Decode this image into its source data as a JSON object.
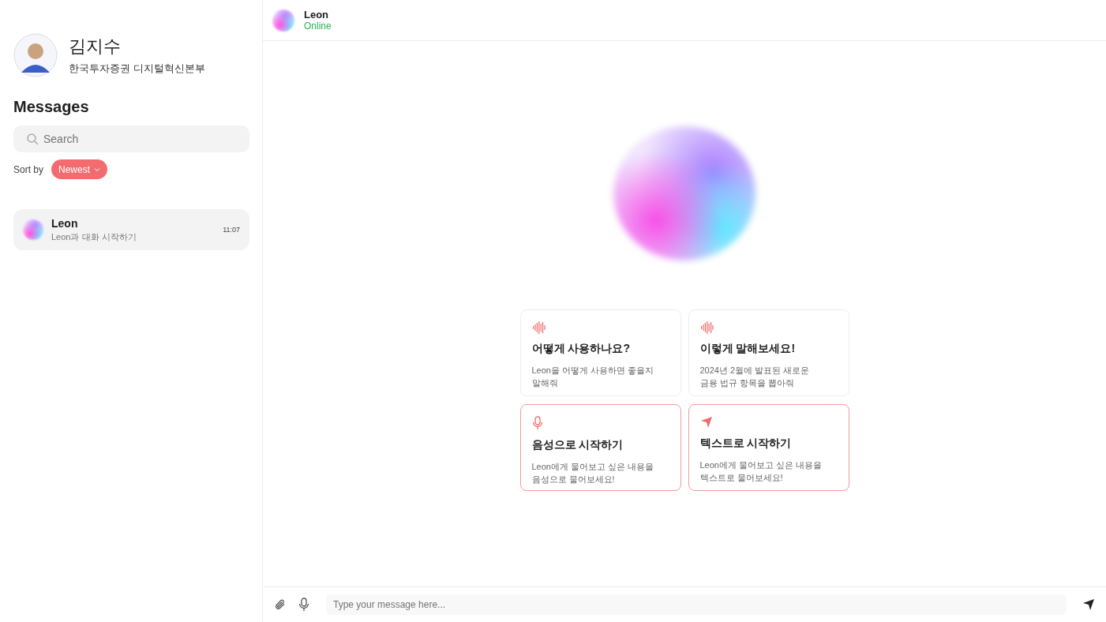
{
  "profile": {
    "name": "김지수",
    "department": "한국투자증권 디지털혁신본부"
  },
  "sidebar": {
    "title": "Messages",
    "search": {
      "placeholder": "Search"
    },
    "sort": {
      "label": "Sort by",
      "value": "Newest"
    },
    "conversations": [
      {
        "name": "Leon",
        "preview": "Leon과 대화 시작하기",
        "time": "11:07"
      }
    ]
  },
  "chat": {
    "name": "Leon",
    "status": "Online",
    "cards": [
      {
        "kind": "prompt",
        "title": "어떻게 사용하나요?",
        "lines": [
          "Leon을 어떻게 사용하면 좋을지",
          "말해줘"
        ]
      },
      {
        "kind": "prompt",
        "title": "이렇게 말해보세요!",
        "lines": [
          "2024년 2월에 발표된 새로운",
          "금융 법규 항목을 뽑아줘"
        ]
      },
      {
        "kind": "voice",
        "title": "음성으로 시작하기",
        "lines": [
          "Leon에게 물어보고 싶은 내용을",
          "음성으로 물어보세요!"
        ]
      },
      {
        "kind": "text",
        "title": "텍스트로 시작하기",
        "lines": [
          "Leon에게 물어보고 싶은 내용을",
          "텍스트로 물어보세요!"
        ]
      }
    ],
    "composer": {
      "placeholder": "Type your message here..."
    }
  }
}
